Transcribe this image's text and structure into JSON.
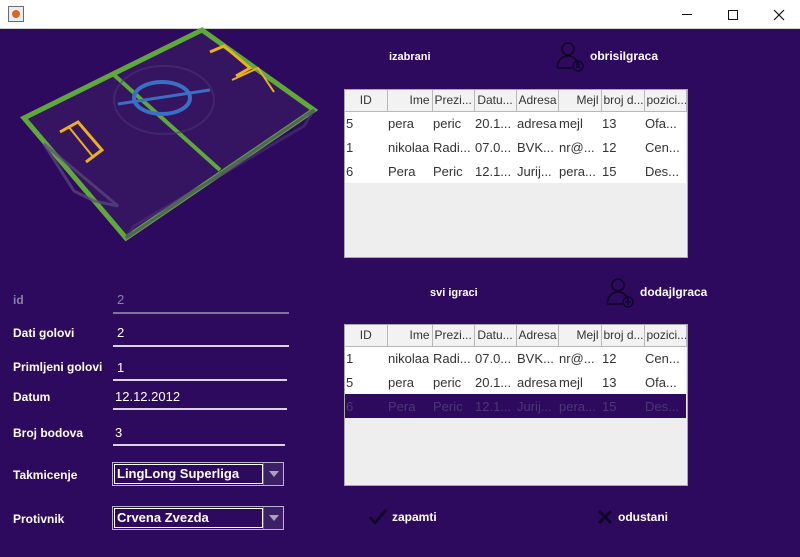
{
  "window": {
    "title": ""
  },
  "form": {
    "id": {
      "label": "id",
      "value": "2"
    },
    "dati_golovi": {
      "label": "Dati golovi",
      "value": "2"
    },
    "primljeni_golovi": {
      "label": "Primljeni golovi",
      "value": "1"
    },
    "datum": {
      "label": "Datum",
      "value": "12.12.2012"
    },
    "broj_bodova": {
      "label": "Broj bodova",
      "value": "3"
    },
    "takmicenje": {
      "label": "Takmicenje",
      "selected": "LingLong Superliga"
    },
    "protivnik": {
      "label": "Protivnik",
      "selected": "Crvena Zvezda"
    }
  },
  "selected_section": {
    "title": "izabrani",
    "remove_label": "obrisiIgraca",
    "columns": [
      "ID",
      "Ime",
      "Prezi...",
      "Datu...",
      "Adresa",
      "Mejl",
      "broj d...",
      "pozici..."
    ],
    "rows": [
      [
        "5",
        "pera",
        "peric",
        "20.1...",
        "adresa",
        "mejl",
        "13",
        "Ofa..."
      ],
      [
        "1",
        "nikolaa",
        "Radi...",
        "07.0...",
        "BVK...",
        "nr@...",
        "12",
        "Cen..."
      ],
      [
        "6",
        "Pera",
        "Peric",
        "12.1...",
        "Jurij...",
        "pera...",
        "15",
        "Des..."
      ]
    ]
  },
  "all_section": {
    "title": "svi igraci",
    "add_label": "dodajIgraca",
    "columns": [
      "ID",
      "Ime",
      "Prezi...",
      "Datu...",
      "Adresa",
      "Mejl",
      "broj d...",
      "pozici..."
    ],
    "rows": [
      [
        "1",
        "nikolaa",
        "Radi...",
        "07.0...",
        "BVK...",
        "nr@...",
        "12",
        "Cen..."
      ],
      [
        "5",
        "pera",
        "peric",
        "20.1...",
        "adresa",
        "mejl",
        "13",
        "Ofa..."
      ],
      [
        "6",
        "Pera",
        "Peric",
        "12.1...",
        "Jurij...",
        "pera...",
        "15",
        "Des..."
      ]
    ],
    "selected_row": 2
  },
  "actions": {
    "save_label": "zapamti",
    "cancel_label": "odustani"
  },
  "icons": {
    "app": "java-cup-icon",
    "remove": "user-remove-icon",
    "add": "user-add-icon",
    "save": "check-icon",
    "cancel": "x-icon"
  },
  "colors": {
    "background": "#2e0a5e",
    "pitch_lines": "#5fa83a",
    "goal_box": "#e8b21c",
    "center_circle": "#3a6fc4"
  }
}
